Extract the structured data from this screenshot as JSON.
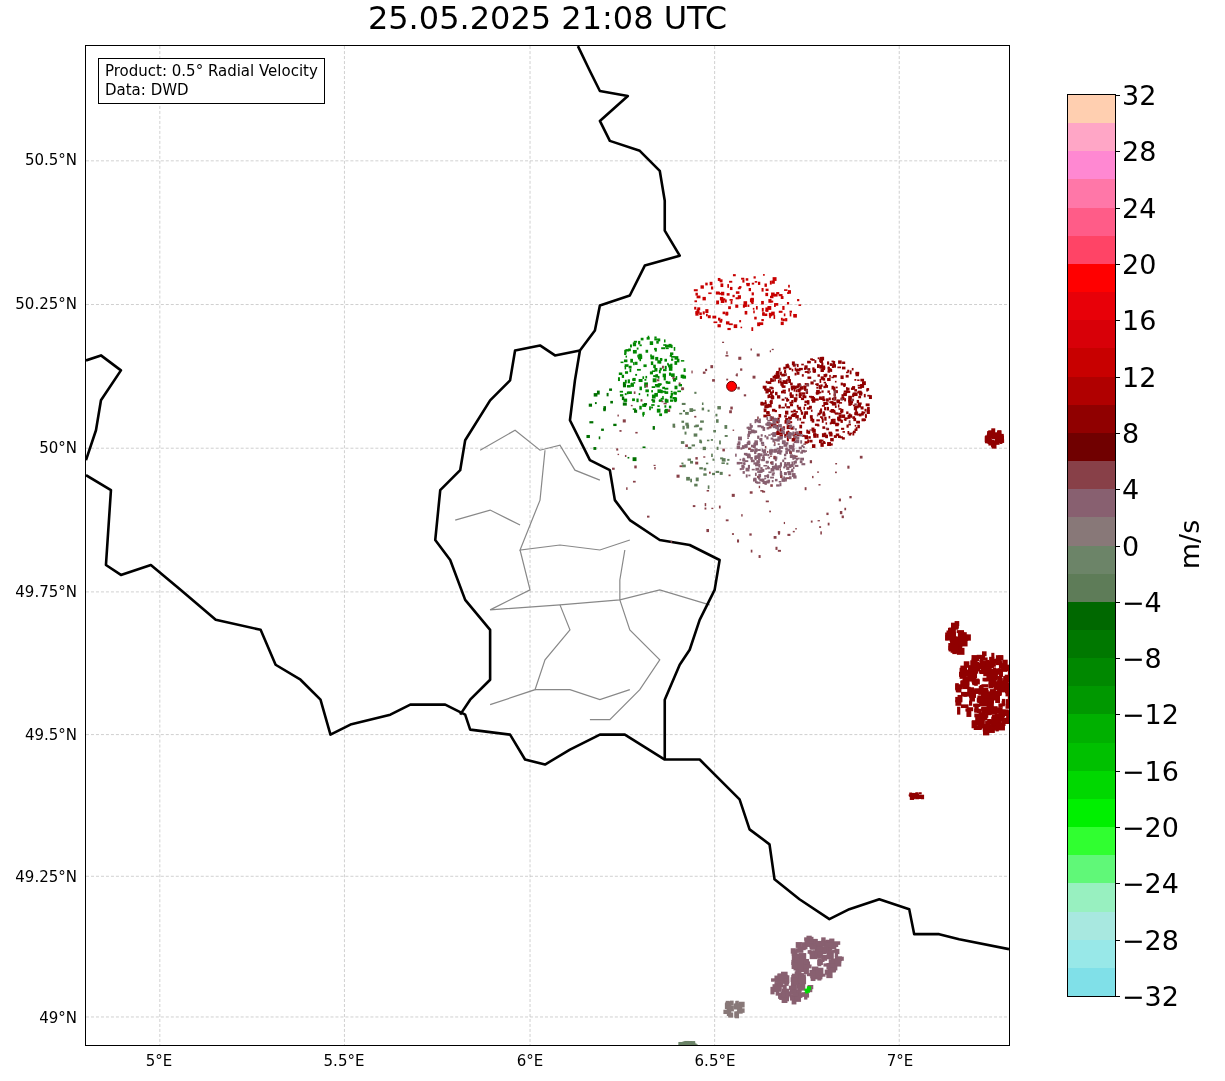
{
  "title": "25.05.2025 21:08 UTC",
  "info_box": {
    "lines": [
      "Product: 0.5° Radial Velocity",
      "Data: DWD"
    ]
  },
  "map": {
    "kind": "map",
    "y_ticks": [
      "50.5°N",
      "50.25°N",
      "50°N",
      "49.75°N",
      "49.5°N",
      "49.25°N",
      "49°N"
    ],
    "x_ticks": [
      "5°E",
      "5.5°E",
      "6°E",
      "6.5°E",
      "7°E"
    ]
  },
  "colorbar": {
    "label": "m/s",
    "ticks": [
      "32",
      "28",
      "24",
      "20",
      "16",
      "12",
      "8",
      "4",
      "0",
      "−4",
      "−8",
      "−12",
      "−16",
      "−20",
      "−24",
      "−28",
      "−32"
    ],
    "steps": [
      {
        "color": "#ffcfb0"
      },
      {
        "color": "#ffa6c6"
      },
      {
        "color": "#ff88d2"
      },
      {
        "color": "#ff77a8"
      },
      {
        "color": "#ff5c88"
      },
      {
        "color": "#ff4466"
      },
      {
        "color": "#ff0000"
      },
      {
        "color": "#e80008"
      },
      {
        "color": "#d80008"
      },
      {
        "color": "#c80000"
      },
      {
        "color": "#b00000"
      },
      {
        "color": "#900000"
      },
      {
        "color": "#700000"
      },
      {
        "color": "#884048"
      },
      {
        "color": "#886070"
      },
      {
        "color": "#887878"
      },
      {
        "color": "#6c8468"
      },
      {
        "color": "#5e7c58"
      },
      {
        "color": "#006800"
      },
      {
        "color": "#007800"
      },
      {
        "color": "#008800"
      },
      {
        "color": "#009800"
      },
      {
        "color": "#00b000"
      },
      {
        "color": "#00c000"
      },
      {
        "color": "#00d800"
      },
      {
        "color": "#00f000"
      },
      {
        "color": "#30ff30"
      },
      {
        "color": "#60f878"
      },
      {
        "color": "#98f0c0"
      },
      {
        "color": "#a8e8e0"
      },
      {
        "color": "#98e8e8"
      },
      {
        "color": "#80e0e8"
      }
    ]
  }
}
